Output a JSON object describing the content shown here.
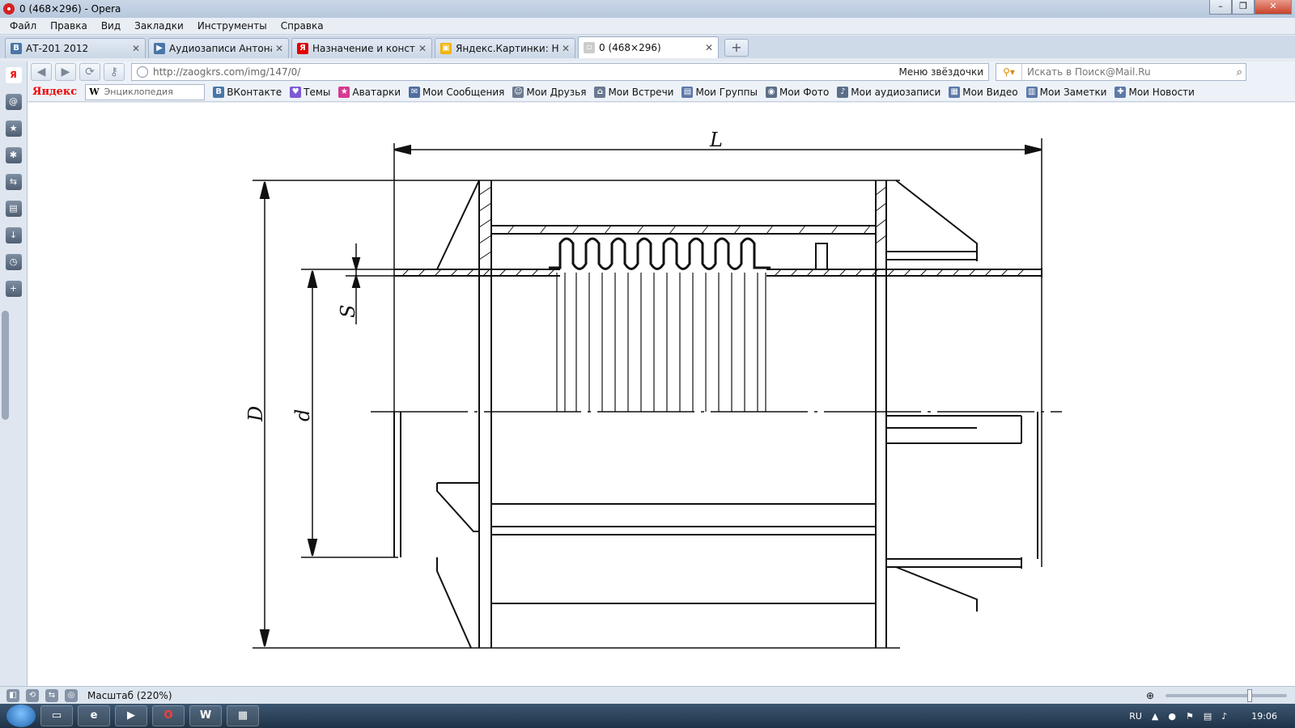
{
  "window": {
    "title": "0 (468×296) - Opera",
    "controls": [
      "–",
      "❐",
      "✕"
    ]
  },
  "menu": [
    "Файл",
    "Правка",
    "Вид",
    "Закладки",
    "Инструменты",
    "Справка"
  ],
  "tabs": [
    {
      "label": "АТ-201 2012",
      "icon": "vk-icon",
      "color": "#4a76a8",
      "glyph": "B",
      "active": false
    },
    {
      "label": "Аудиозаписи Антона ...",
      "icon": "play-icon",
      "color": "#4a76a8",
      "glyph": "▶",
      "active": false
    },
    {
      "label": "Назначение и констр...",
      "icon": "yandex-icon",
      "color": "#e00000",
      "glyph": "Я",
      "active": false
    },
    {
      "label": "Яндекс.Картинки: Наз...",
      "icon": "yandex-images-icon",
      "color": "#f2b400",
      "glyph": "▣",
      "active": false
    },
    {
      "label": "0 (468×296)",
      "icon": "image-icon",
      "color": "#cccccc",
      "glyph": "▫",
      "active": true
    }
  ],
  "address": {
    "url": "http://zaogkrs.com/img/147/0/",
    "bookmarks_label": "Меню звёздочки",
    "search_placeholder": "Искать в Поиск@Mail.Ru"
  },
  "bookmarks_bar": {
    "yandex_logo": "Яндекс",
    "encyclopedia_placeholder": "Энциклопедия",
    "items": [
      {
        "label": "ВКонтакте",
        "icon": "vk-icon",
        "color": "#4a76a8",
        "glyph": "B"
      },
      {
        "label": "Темы",
        "icon": "heart-icon",
        "color": "#7d5ad6",
        "glyph": "♥"
      },
      {
        "label": "Аватарки",
        "icon": "star-icon",
        "color": "#d63a8f",
        "glyph": "★"
      },
      {
        "label": "Мои Сообщения",
        "icon": "envelope-icon",
        "color": "#4f6ea0",
        "glyph": "✉"
      },
      {
        "label": "Мои Друзья",
        "icon": "person-icon",
        "color": "#6a7a90",
        "glyph": "☺"
      },
      {
        "label": "Мои Встречи",
        "icon": "house-icon",
        "color": "#6a7a90",
        "glyph": "⌂"
      },
      {
        "label": "Мои Группы",
        "icon": "group-icon",
        "color": "#5c79a8",
        "glyph": "▤"
      },
      {
        "label": "Мои Фото",
        "icon": "camera-icon",
        "color": "#5c6e88",
        "glyph": "◉"
      },
      {
        "label": "Мои аудиозаписи",
        "icon": "speaker-icon",
        "color": "#5c6e88",
        "glyph": "♪"
      },
      {
        "label": "Мои Видео",
        "icon": "video-icon",
        "color": "#5c79a8",
        "glyph": "▦"
      },
      {
        "label": "Мои Заметки",
        "icon": "note-icon",
        "color": "#5c79a8",
        "glyph": "▥"
      },
      {
        "label": "Мои Новости",
        "icon": "plus-icon",
        "color": "#5c79a8",
        "glyph": "✚"
      }
    ]
  },
  "drawing": {
    "labels": {
      "L": "L",
      "D": "D",
      "d": "d",
      "S": "S"
    }
  },
  "status": {
    "zoom_text": "Масштаб (220%)",
    "zoom_level": 0.7
  },
  "taskbar": {
    "lang": "RU",
    "time": "19:06"
  }
}
